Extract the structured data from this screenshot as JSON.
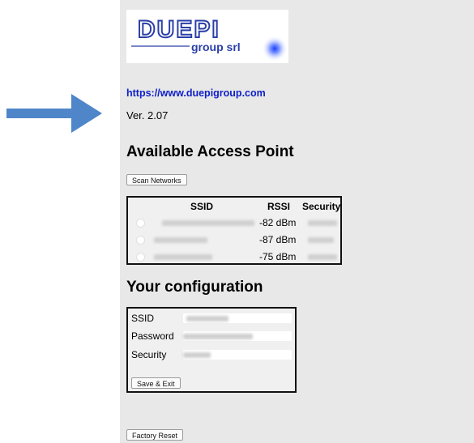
{
  "logo": {
    "text_main": "DUEPI",
    "text_sub": "group srl"
  },
  "link": "https://www.duepigroup.com",
  "version": "Ver. 2.07",
  "access_points": {
    "heading": "Available Access Point",
    "scan_button": "Scan Networks",
    "columns": [
      "SSID",
      "RSSI",
      "Security"
    ],
    "rows": [
      {
        "rssi": "-82 dBm"
      },
      {
        "rssi": "-87 dBm"
      },
      {
        "rssi": "-75 dBm"
      }
    ]
  },
  "config": {
    "heading": "Your configuration",
    "fields": [
      {
        "label": "SSID"
      },
      {
        "label": "Password"
      },
      {
        "label": "Security"
      }
    ],
    "save_button": "Save & Exit"
  },
  "factory_reset_button": "Factory Reset",
  "colors": {
    "arrow": "#4f86c9",
    "link": "#1020c8",
    "panel": "#e8e8e8",
    "logo_blue": "#2b3fa8"
  }
}
